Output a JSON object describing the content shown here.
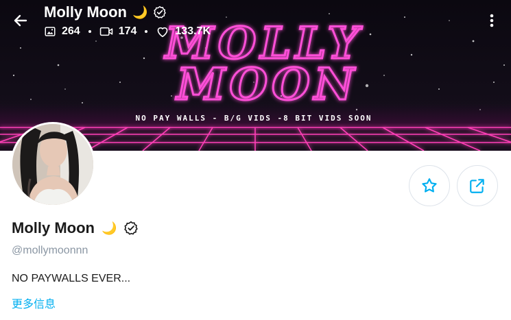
{
  "header": {
    "name": "Molly Moon",
    "moon_emoji": "🌙",
    "stats": {
      "photos": "264",
      "videos": "174",
      "likes": "133.7K"
    }
  },
  "banner": {
    "line1": "MOLLY",
    "line2": "MOON",
    "tagline": "NO PAY WALLS - B/G VIDS -8 BIT VIDS SOON"
  },
  "profile": {
    "name": "Molly Moon",
    "moon_emoji": "🌙",
    "handle": "@mollymoonnn",
    "bio": "NO PAYWALLS EVER...",
    "more_info": "更多信息"
  },
  "colors": {
    "accent": "#00aff0",
    "neon_pink": "#ff4fd8",
    "muted": "#8a96a3"
  },
  "icons": [
    "back-arrow-icon",
    "verified-icon",
    "image-icon",
    "video-icon",
    "heart-icon",
    "kebab-menu-icon",
    "star-icon",
    "share-icon"
  ]
}
